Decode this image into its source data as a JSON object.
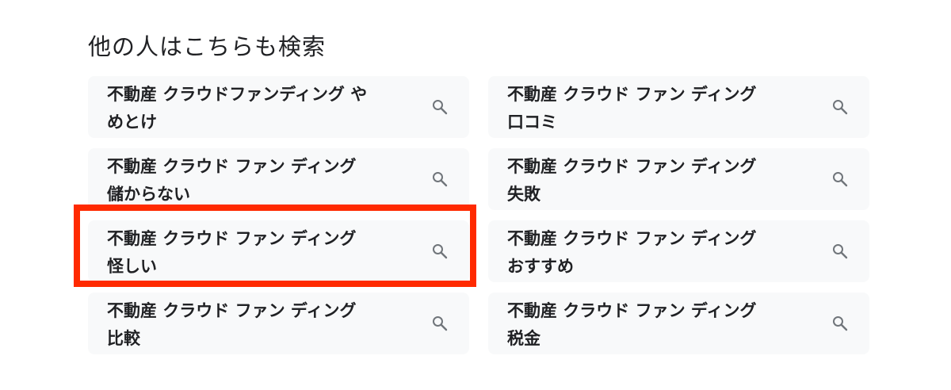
{
  "section": {
    "title": "他の人はこちらも検索"
  },
  "suggestions": [
    {
      "line1": "不動産 クラウドファンディング や",
      "line2": "めとけ"
    },
    {
      "line1": "不動産 クラウド ファン ディング",
      "line2": "口コミ"
    },
    {
      "line1": "不動産 クラウド ファン ディング",
      "line2": "儲からない"
    },
    {
      "line1": "不動産 クラウド ファン ディング",
      "line2": "失敗"
    },
    {
      "line1": "不動産 クラウド ファン ディング",
      "line2": "怪しい"
    },
    {
      "line1": "不動産 クラウド ファン ディング",
      "line2": "おすすめ"
    },
    {
      "line1": "不動産 クラウド ファン ディング",
      "line2": "比較"
    },
    {
      "line1": "不動産 クラウド ファン ディング",
      "line2": "税金"
    }
  ],
  "icons": {
    "search": "search-icon"
  },
  "colors": {
    "chip_background": "#f8f9fa",
    "text": "#202124",
    "icon": "#70757a",
    "highlight": "#ff2a00"
  }
}
